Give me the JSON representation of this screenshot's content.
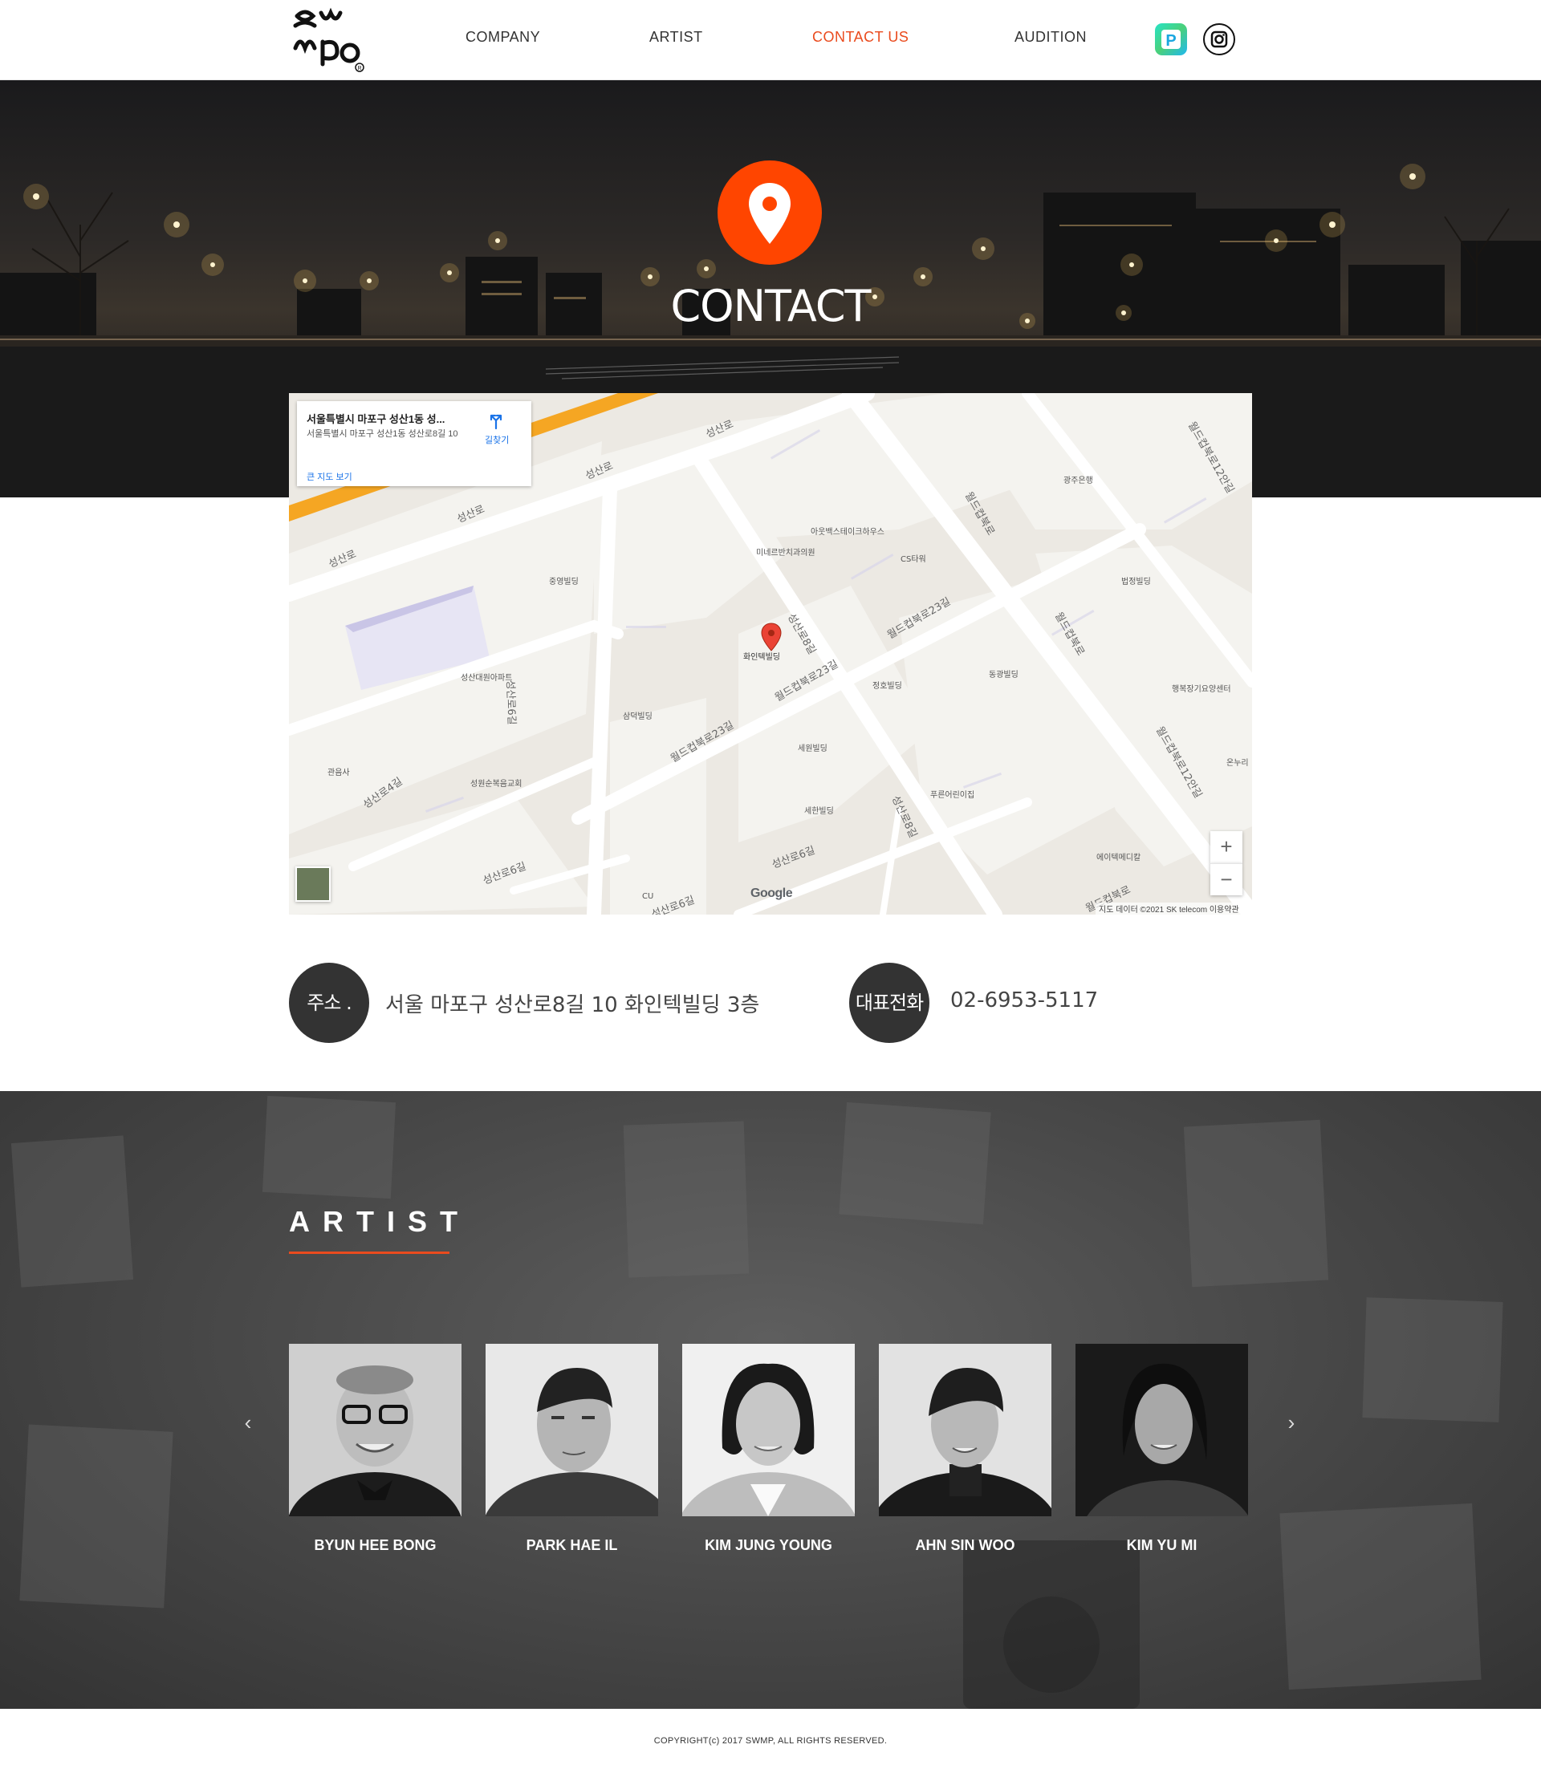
{
  "header": {
    "logo_text": "SWMP",
    "nav": [
      {
        "label": "COMPANY"
      },
      {
        "label": "ARTIST"
      },
      {
        "label": "CONTACT US"
      },
      {
        "label": "AUDITION"
      }
    ],
    "active_nav": "CONTACT US",
    "social_icons": [
      "naver-post-icon",
      "instagram-icon"
    ],
    "accent_color": "#ea4b1e"
  },
  "hero": {
    "title": "CONTACT",
    "icon": "location-pin-icon",
    "icon_color": "#ff4500"
  },
  "map": {
    "card": {
      "title": "서울특별시 마포구 성산1동 성...",
      "address": "서울특별시 마포구 성산1동 성산로8길 10",
      "larger_map_link": "큰 지도 보기",
      "directions_label": "길찾기"
    },
    "marker_label": "화인텍빌딩",
    "roads": [
      "성산로",
      "성산로",
      "성산로",
      "성산로",
      "월드컵북로",
      "월드컵북로",
      "월드컵북로12안길",
      "성산로8길",
      "성산로8길",
      "월드컵북로23길",
      "월드컵북로23길",
      "월드컵북로23길",
      "성산로6길",
      "성산로6길",
      "성산로4길",
      "성산로6길",
      "성산로6길",
      "월드컵북로"
    ],
    "places": [
      "광주은행",
      "아웃백스테이크하우스",
      "미네르반치과의원",
      "CS타워",
      "중영빌딩",
      "성산대원아파트",
      "삼덕빌딩",
      "정호빌딩",
      "동광빌딩",
      "법정빌딩",
      "행복장기요양센터",
      "세원빌딩",
      "세한빌딩",
      "푸른어린이집",
      "성원순복음교회",
      "관음사",
      "에이텍메디칼",
      "온누리",
      "CU"
    ],
    "zoom_in": "+",
    "zoom_out": "−",
    "google_logo": "Google",
    "attribution": "지도 데이터 ©2021 SK telecom   이용약관"
  },
  "info": {
    "address_label": "주소 .",
    "address_value": "서울 마포구 성산로8길 10 화인텍빌딩 3층",
    "phone_label": "대표전화",
    "phone_value": "02-6953-5117"
  },
  "artist": {
    "heading": "ARTIST",
    "prev": "‹",
    "next": "›",
    "items": [
      {
        "name": "BYUN HEE BONG"
      },
      {
        "name": "PARK HAE IL"
      },
      {
        "name": "KIM JUNG YOUNG"
      },
      {
        "name": "AHN SIN WOO"
      },
      {
        "name": "KIM YU MI"
      }
    ]
  },
  "footer": {
    "copyright": "COPYRIGHT(c) 2017 SWMP, ALL RIGHTS RESERVED."
  }
}
